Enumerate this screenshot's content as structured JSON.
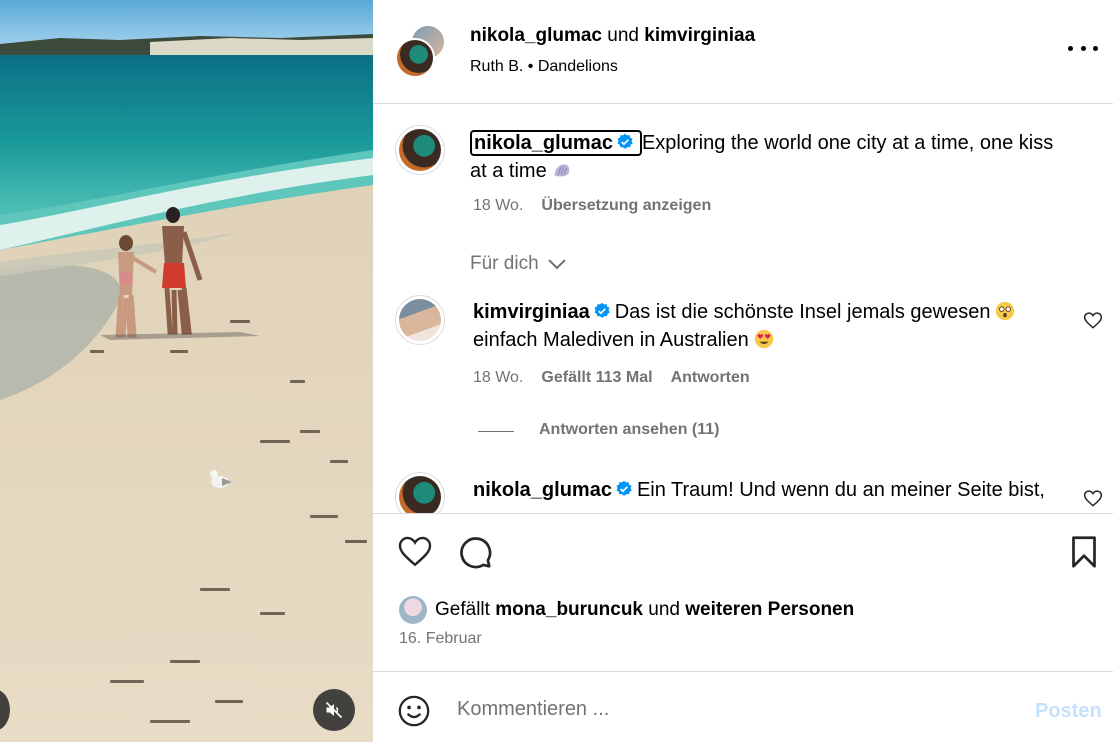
{
  "post": {
    "author_primary": "nikola_glumac",
    "and_word": "und",
    "author_secondary": "kimvirginiaa",
    "audio": "Ruth B. • Dandelions"
  },
  "caption": {
    "username": "nikola_glumac",
    "text_line1": "Exploring the world one city at a time, one kiss",
    "text_line2": "at a time",
    "time": "18 Wo.",
    "translate": "Übersetzung anzeigen"
  },
  "filter": {
    "label": "Für dich"
  },
  "comments": [
    {
      "username": "kimvirginiaa",
      "text_line1": "Das ist die schönste Insel jemals gewesen",
      "text_line2": "einfach Malediven in Australien",
      "time": "18 Wo.",
      "likes": "Gefällt 113 Mal",
      "reply": "Antworten",
      "view_replies": "Antworten ansehen (11)"
    },
    {
      "username": "nikola_glumac",
      "text_line1": "Ein Traum! Und wenn du an meiner Seite bist,"
    }
  ],
  "likes_line": {
    "prefix": "Gefällt",
    "user": "mona_buruncuk",
    "mid": "und",
    "rest": "weiteren Personen"
  },
  "date": "16. Februar",
  "composer": {
    "placeholder": "Kommentieren ...",
    "post_label": "Posten"
  },
  "icons": {
    "more": "more-horizontal-icon",
    "like": "heart-icon",
    "comment": "comment-icon",
    "save": "bookmark-icon",
    "emoji": "smiley-icon",
    "mute": "muted-speaker-icon",
    "verified": "verified-badge-icon"
  },
  "colors": {
    "verified": "#0095f6",
    "muted_text": "#737373",
    "post_disabled": "#c7e0fd",
    "divider": "#dbdbdb"
  }
}
